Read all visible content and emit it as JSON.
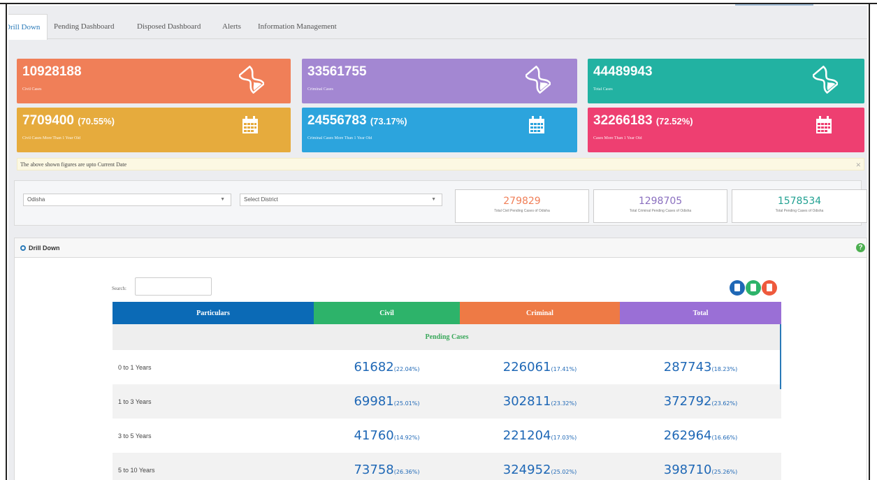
{
  "tabs": [
    "Drill Down",
    "Pending Dashboard",
    "Disposed Dashboard",
    "Alerts",
    "Information Management"
  ],
  "cards": [
    {
      "value": "10928188",
      "pct": "",
      "label": "Civil Cases",
      "color": "#f07f58",
      "icon": "hourglass-icon"
    },
    {
      "value": "33561755",
      "pct": "",
      "label": "Criminal Cases",
      "color": "#a387d2",
      "icon": "hourglass-icon"
    },
    {
      "value": "44489943",
      "pct": "",
      "label": "Total Cases",
      "color": "#22b2a2",
      "icon": "hourglass-icon"
    },
    {
      "value": "7709400",
      "pct": "(70.55%)",
      "label": "Civil Cases More Than 1 Year Old",
      "color": "#e6ab3d",
      "icon": "calendar-icon"
    },
    {
      "value": "24556783",
      "pct": "(73.17%)",
      "label": "Criminal Cases More Than 1 Year Old",
      "color": "#2ca4dd",
      "icon": "calendar-icon"
    },
    {
      "value": "32266183",
      "pct": "(72.52%)",
      "label": "Cases More Than 1 Year Old",
      "color": "#ee3f71",
      "icon": "calendar-icon"
    }
  ],
  "notice": "The above shown figures are upto Current Date",
  "filters": {
    "state": "Odisha",
    "district": "Select District"
  },
  "summary": [
    {
      "value": "279829",
      "label": "Total Civil Pending Cases of Odisha",
      "color": "#f07f58"
    },
    {
      "value": "1298705",
      "label": "Total Criminal Pending Cases of Odisha",
      "color": "#8a6fbf"
    },
    {
      "value": "1578534",
      "label": "Total Pending Cases of Odisha",
      "color": "#22a192"
    }
  ],
  "panel": {
    "title": "Drill Down",
    "search_label": "Search:"
  },
  "table": {
    "headers": [
      "Particulars",
      "Civil",
      "Criminal",
      "Total"
    ],
    "header_colors": [
      "#0b6ab6",
      "#2db36a",
      "#ee7a45",
      "#9a6fd6"
    ],
    "section": "Pending Cases",
    "rows": [
      {
        "label": "0 to 1 Years",
        "civil": "61682",
        "civil_pct": "(22.04%)",
        "criminal": "226061",
        "criminal_pct": "(17.41%)",
        "total": "287743",
        "total_pct": "(18.23%)"
      },
      {
        "label": "1 to 3 Years",
        "civil": "69981",
        "civil_pct": "(25.01%)",
        "criminal": "302811",
        "criminal_pct": "(23.32%)",
        "total": "372792",
        "total_pct": "(23.62%)"
      },
      {
        "label": "3 to 5 Years",
        "civil": "41760",
        "civil_pct": "(14.92%)",
        "criminal": "221204",
        "criminal_pct": "(17.03%)",
        "total": "262964",
        "total_pct": "(16.66%)"
      },
      {
        "label": "5 to 10 Years",
        "civil": "73758",
        "civil_pct": "(26.36%)",
        "criminal": "324952",
        "criminal_pct": "(25.02%)",
        "total": "398710",
        "total_pct": "(25.26%)"
      }
    ]
  },
  "export_buttons": [
    {
      "name": "pdf-export-button",
      "color": "#1f68b6"
    },
    {
      "name": "excel-export-button",
      "color": "#2db36a"
    },
    {
      "name": "pdf-download-button",
      "color": "#ee5a3d"
    }
  ]
}
